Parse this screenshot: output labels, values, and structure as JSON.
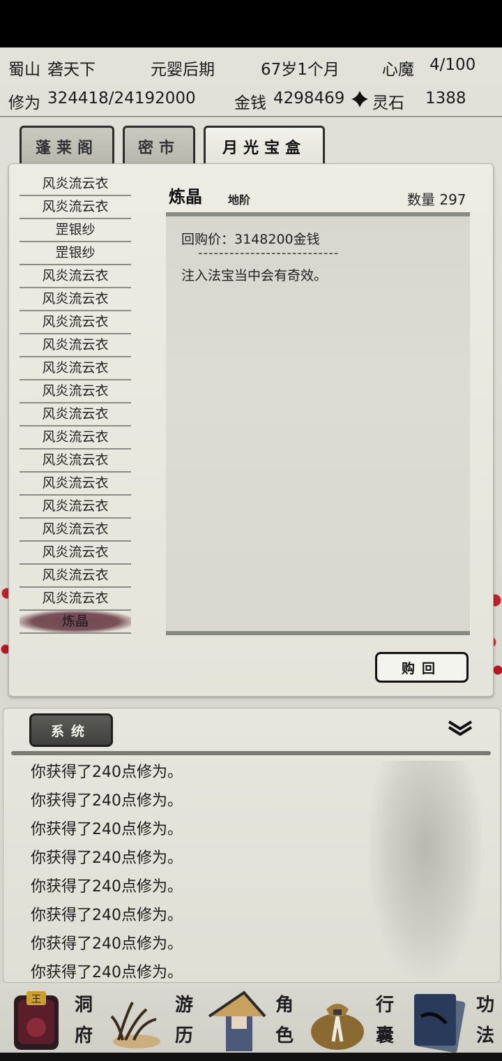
{
  "header": {
    "sect": "蜀山",
    "name": "砻天下",
    "realm": "元婴后期",
    "age": "67岁1个月",
    "demon_label": "心魔",
    "demon_value": "4/100",
    "cultivation_label": "修为",
    "cultivation_value": "324418/24192000",
    "money_label": "金钱",
    "money_value": "4298469",
    "spirit_stone_label": "灵石",
    "spirit_stone_value": "1388"
  },
  "tabs": [
    {
      "label": "蓬莱阁"
    },
    {
      "label": "密市"
    },
    {
      "label": "月光宝盒"
    }
  ],
  "items": [
    "风炎流云衣",
    "风炎流云衣",
    "罡银纱",
    "罡银纱",
    "风炎流云衣",
    "风炎流云衣",
    "风炎流云衣",
    "风炎流云衣",
    "风炎流云衣",
    "风炎流云衣",
    "风炎流云衣",
    "风炎流云衣",
    "风炎流云衣",
    "风炎流云衣",
    "风炎流云衣",
    "风炎流云衣",
    "风炎流云衣",
    "风炎流云衣",
    "风炎流云衣",
    "炼晶"
  ],
  "detail": {
    "title": "炼晶",
    "grade": "地阶",
    "quantity_label": "数量",
    "quantity": "297",
    "price_text": "回购价：3148200金钱",
    "divider": "---------------------------",
    "description": "注入法宝当中会有奇效。"
  },
  "buyback_label": "购回",
  "log": {
    "tab_label": "系统",
    "messages": [
      "你获得了240点修为。",
      "你获得了240点修为。",
      "你获得了240点修为。",
      "你获得了240点修为。",
      "你获得了240点修为。",
      "你获得了240点修为。",
      "你获得了240点修为。",
      "你获得了240点修为。"
    ]
  },
  "nav": [
    {
      "label_top": "洞",
      "label_bottom": "府",
      "icon": "cave-dwelling-icon"
    },
    {
      "label_top": "游",
      "label_bottom": "历",
      "icon": "travel-icon"
    },
    {
      "label_top": "角",
      "label_bottom": "色",
      "icon": "character-icon"
    },
    {
      "label_top": "行",
      "label_bottom": "囊",
      "icon": "bag-icon"
    },
    {
      "label_top": "功",
      "label_bottom": "法",
      "icon": "technique-book-icon"
    }
  ],
  "colors": {
    "selected_item": "#7a5058",
    "panel": "#ecece4",
    "log_tab": "#4a4a45"
  }
}
